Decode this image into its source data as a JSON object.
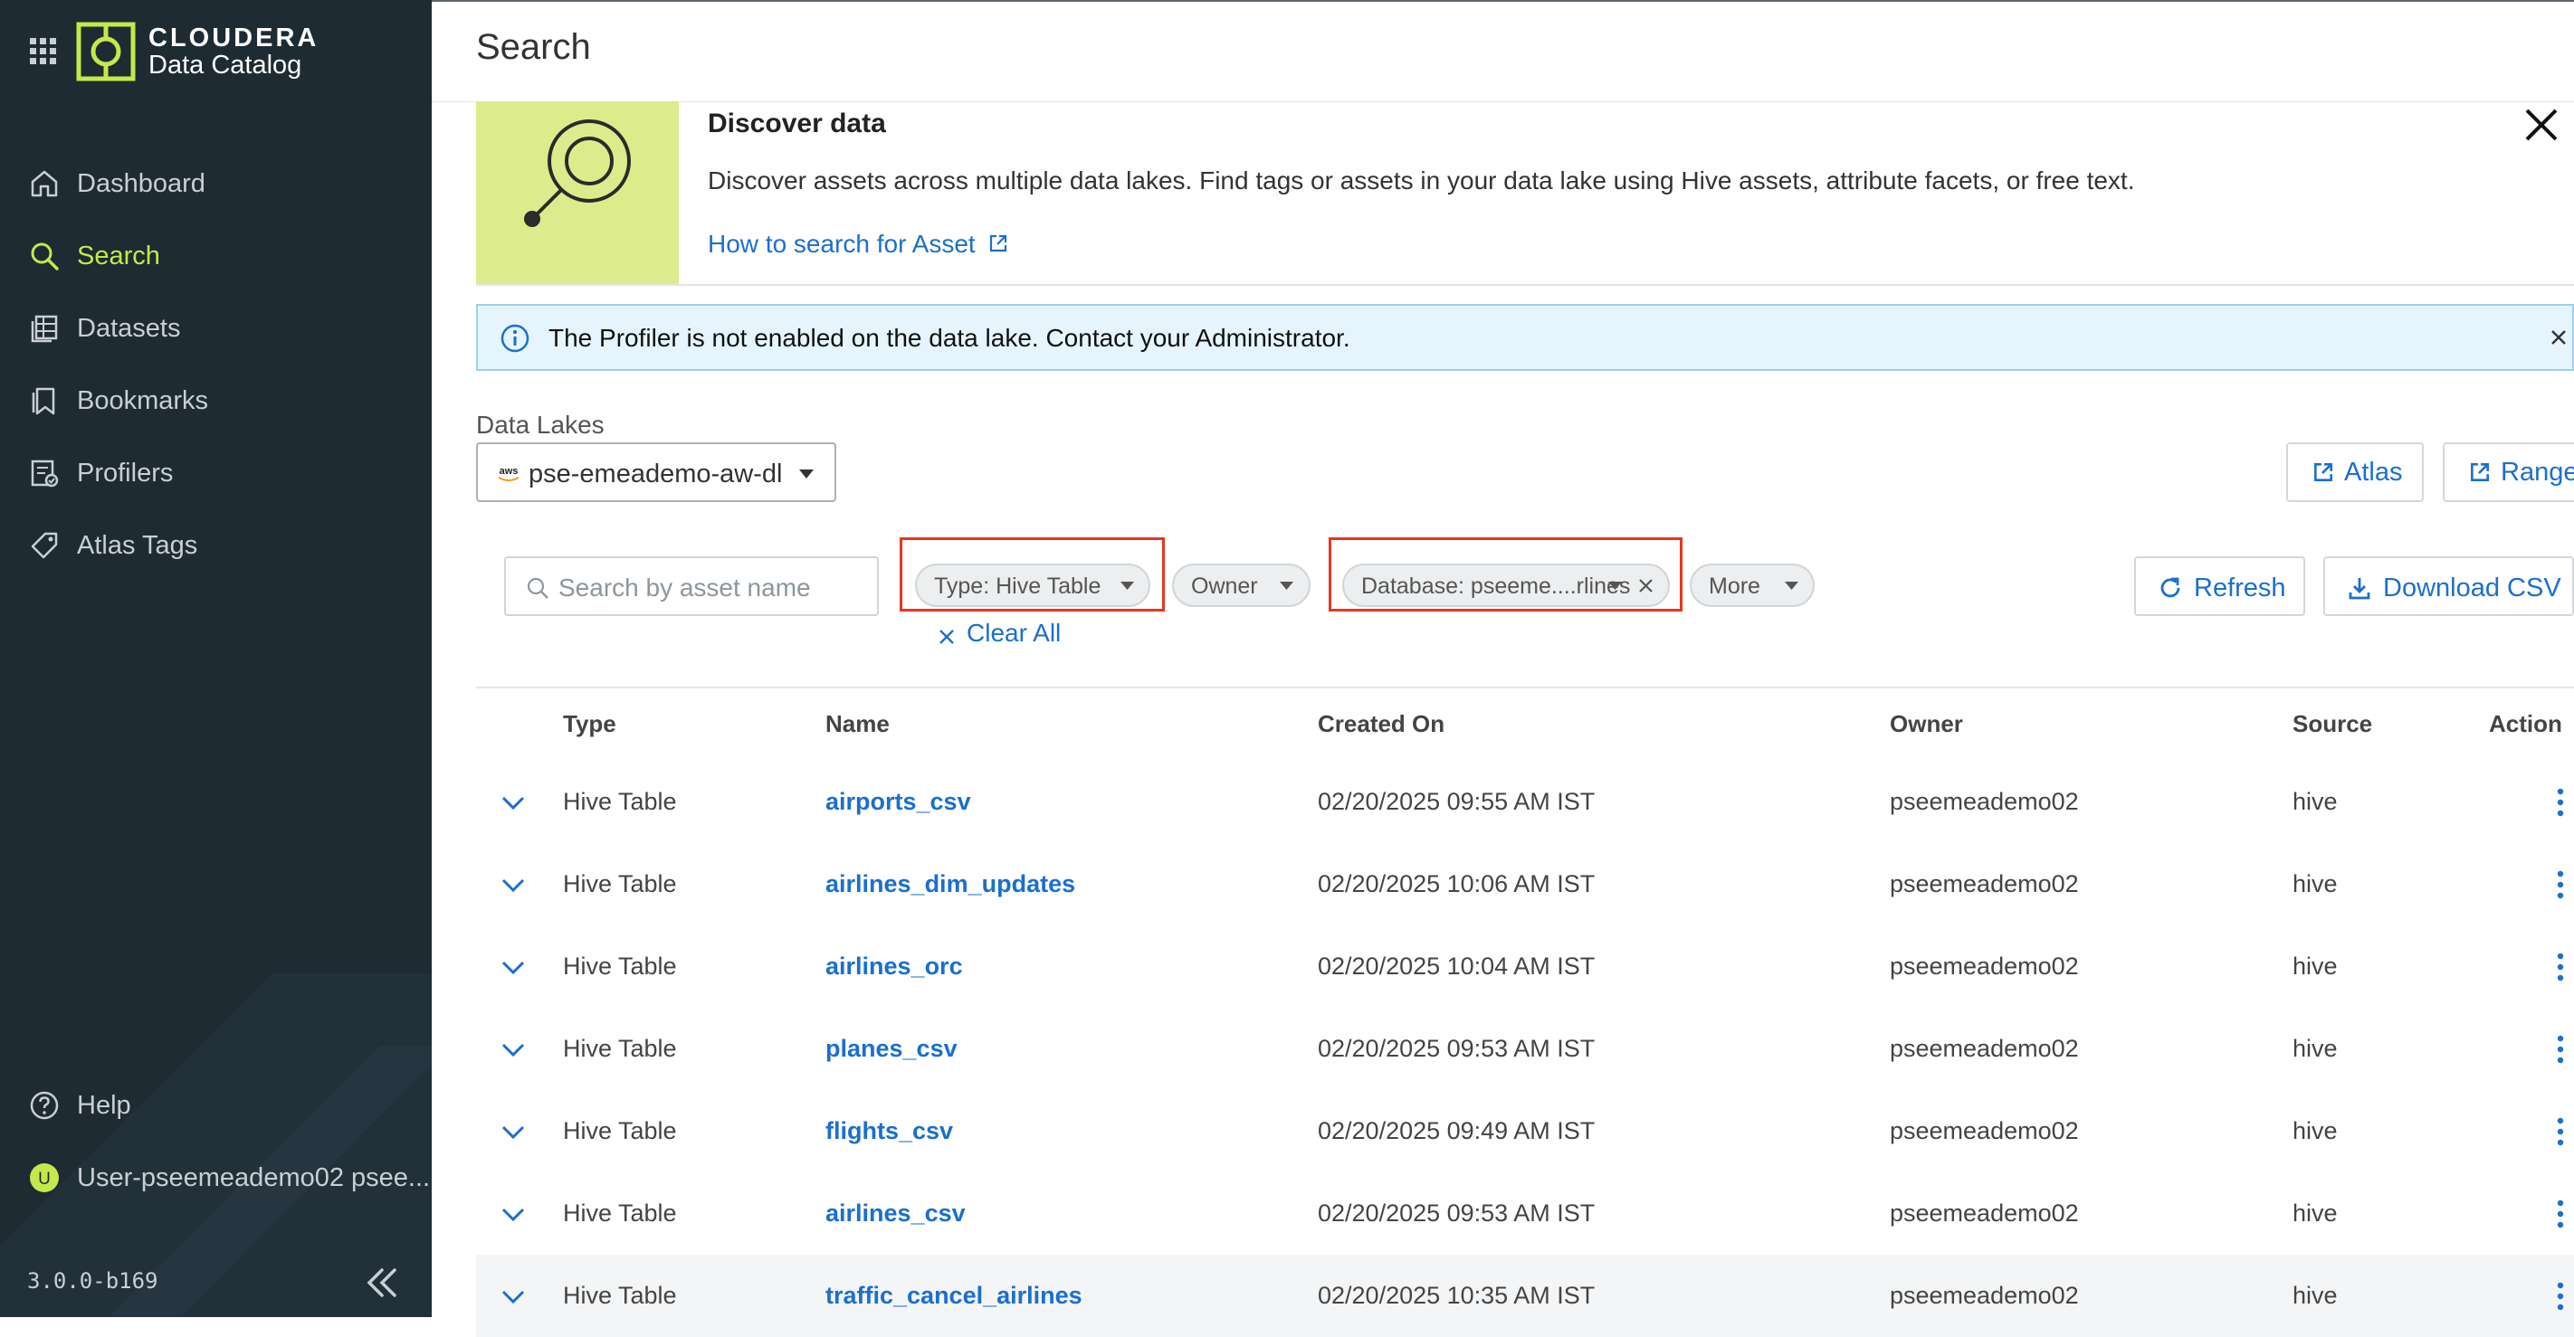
{
  "sidebar": {
    "brand": {
      "name": "CLOUDERA",
      "product": "Data Catalog"
    },
    "items": [
      {
        "label": "Dashboard",
        "icon": "home-icon"
      },
      {
        "label": "Search",
        "icon": "search-icon",
        "active": true
      },
      {
        "label": "Datasets",
        "icon": "datasets-icon"
      },
      {
        "label": "Bookmarks",
        "icon": "bookmark-icon"
      },
      {
        "label": "Profilers",
        "icon": "profilers-icon"
      },
      {
        "label": "Atlas Tags",
        "icon": "tag-icon"
      }
    ],
    "help_label": "Help",
    "user": {
      "initial": "U",
      "label": "User-pseemeademo02 psee..."
    },
    "version": "3.0.0-b169",
    "colors": {
      "background": "#1e2b33",
      "accent": "#c5e84a"
    }
  },
  "header": {
    "title": "Search"
  },
  "discover": {
    "title": "Discover data",
    "description": "Discover assets across multiple data lakes. Find tags or assets in your data lake using Hive assets, attribute facets, or free text.",
    "link": "How to search for Asset"
  },
  "alert": {
    "message": "The Profiler is not enabled on the data lake. Contact your Administrator."
  },
  "data_lakes": {
    "label": "Data Lakes",
    "selected": "pse-emeademo-aw-dl",
    "buttons": {
      "atlas": "Atlas",
      "ranger": "Ranger"
    }
  },
  "filters": {
    "search_placeholder": "Search by asset name",
    "chips": {
      "type": "Type: Hive Table",
      "owner": "Owner",
      "database": "Database: pseeme....rlines",
      "more": "More"
    },
    "clear_all": "Clear All",
    "refresh": "Refresh",
    "download": "Download CSV"
  },
  "table": {
    "columns": {
      "type": "Type",
      "name": "Name",
      "created": "Created On",
      "owner": "Owner",
      "source": "Source",
      "action": "Action"
    },
    "rows": [
      {
        "type": "Hive Table",
        "name": "airports_csv",
        "created": "02/20/2025 09:55 AM IST",
        "owner": "pseemeademo02",
        "source": "hive"
      },
      {
        "type": "Hive Table",
        "name": "airlines_dim_updates",
        "created": "02/20/2025 10:06 AM IST",
        "owner": "pseemeademo02",
        "source": "hive"
      },
      {
        "type": "Hive Table",
        "name": "airlines_orc",
        "created": "02/20/2025 10:04 AM IST",
        "owner": "pseemeademo02",
        "source": "hive"
      },
      {
        "type": "Hive Table",
        "name": "planes_csv",
        "created": "02/20/2025 09:53 AM IST",
        "owner": "pseemeademo02",
        "source": "hive"
      },
      {
        "type": "Hive Table",
        "name": "flights_csv",
        "created": "02/20/2025 09:49 AM IST",
        "owner": "pseemeademo02",
        "source": "hive"
      },
      {
        "type": "Hive Table",
        "name": "airlines_csv",
        "created": "02/20/2025 09:53 AM IST",
        "owner": "pseemeademo02",
        "source": "hive"
      },
      {
        "type": "Hive Table",
        "name": "traffic_cancel_airlines",
        "created": "02/20/2025 10:35 AM IST",
        "owner": "pseemeademo02",
        "source": "hive"
      }
    ]
  }
}
